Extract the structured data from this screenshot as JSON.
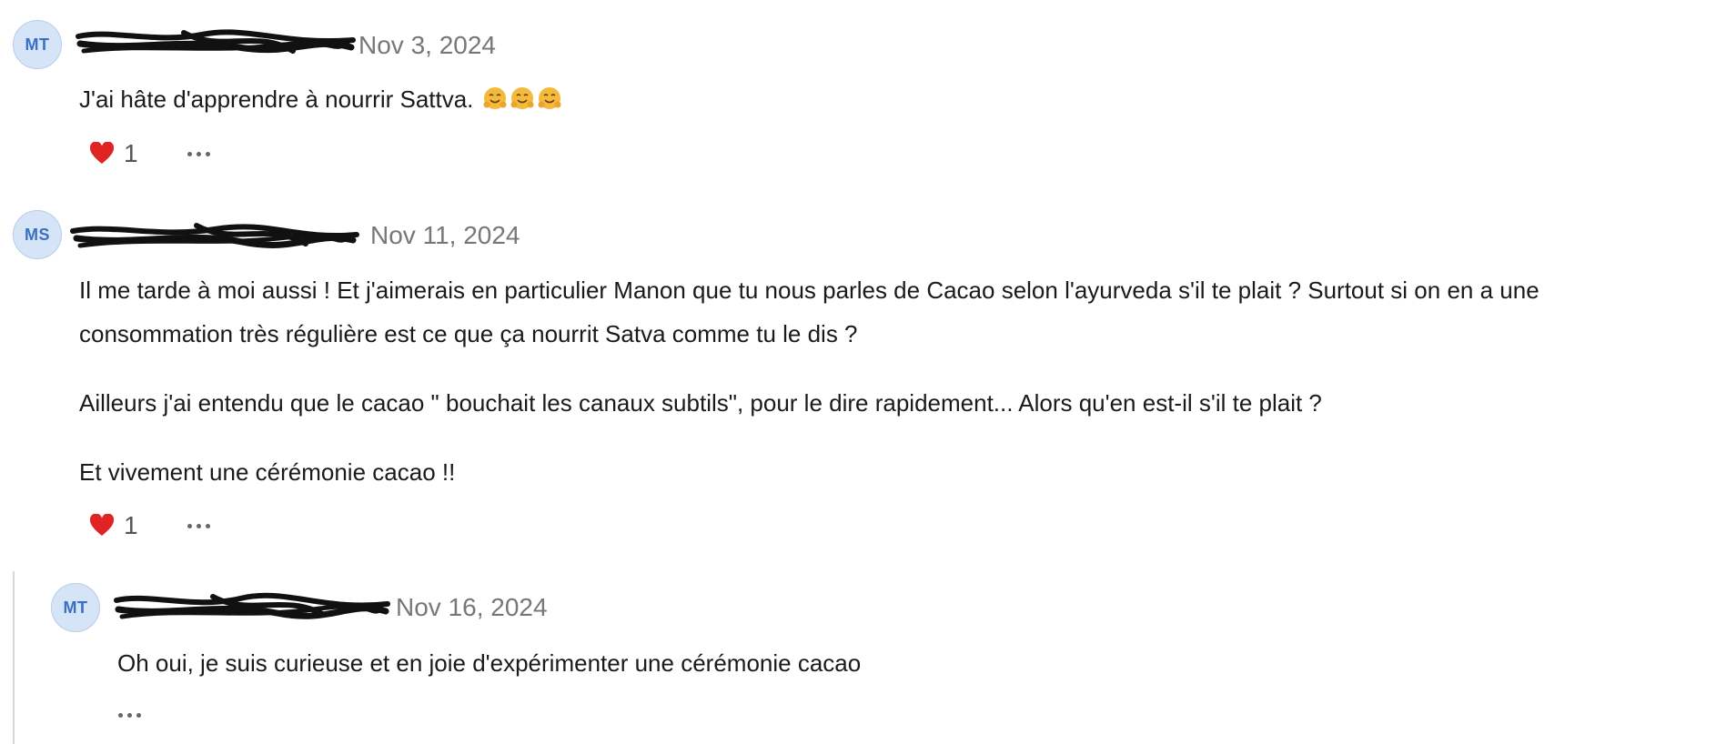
{
  "comments": [
    {
      "initials": "MT",
      "date": "Nov 3, 2024",
      "paragraphs": [
        "J'ai hâte d'apprendre à nourrir Sattva."
      ],
      "emoji_count": 3,
      "reaction_emoji": "heart-icon",
      "reaction_count": "1"
    },
    {
      "initials": "MS",
      "date": "Nov 11, 2024",
      "paragraphs": [
        "Il me tarde à moi aussi ! Et j'aimerais en particulier Manon que tu nous parles de Cacao selon l'ayurveda s'il te plait ? Surtout si on en a une consommation très régulière est ce que ça nourrit Satva comme tu le dis ?",
        "Ailleurs j'ai entendu que le cacao \" bouchait les canaux subtils\", pour le dire rapidement... Alors qu'en est-il s'il te plait ?",
        "Et vivement une cérémonie cacao !!"
      ],
      "reaction_emoji": "heart-icon",
      "reaction_count": "1"
    }
  ],
  "reply": {
    "initials": "MT",
    "date": "Nov 16, 2024",
    "paragraphs": [
      "Oh oui, je suis curieuse et en joie d'expérimenter une cérémonie cacao"
    ]
  },
  "colors": {
    "avatar_bg": "#d6e4f7",
    "avatar_text": "#3a6fc4",
    "date_text": "#777777",
    "heart": "#e02424"
  }
}
